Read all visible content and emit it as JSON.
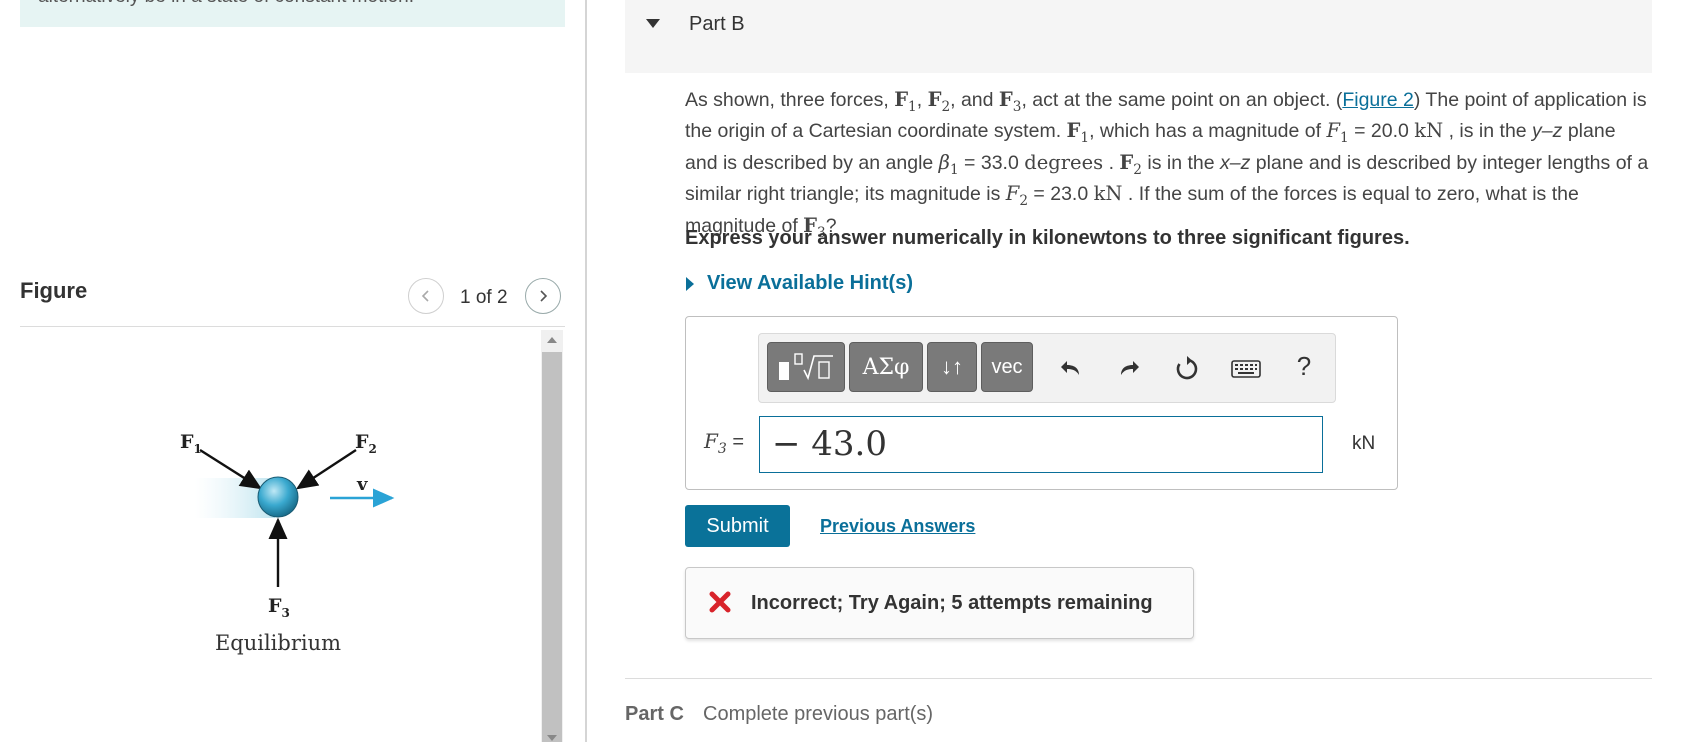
{
  "intro": {
    "text": "alternatively be in a state of constant motion."
  },
  "figure_panel": {
    "title": "Figure",
    "counter": "1 of 2",
    "labels": {
      "f1": "F",
      "f1_sub": "1",
      "f2": "F",
      "f2_sub": "2",
      "f3": "F",
      "f3_sub": "3",
      "v": "v",
      "caption": "Equilibrium"
    }
  },
  "part_b": {
    "title": "Part B",
    "question": {
      "t1": "As shown, three forces, ",
      "f1": "F",
      "s1": "1",
      "t2": ",  ",
      "f2": "F",
      "s2": "2",
      "t3": ", and ",
      "f3": "F",
      "s3": "3",
      "t4": ", act at the same point on an object. (",
      "link": "Figure 2",
      "t5": ") The point of application is the origin of a Cartesian coordinate system. ",
      "f1b": "F",
      "s1b": "1",
      "t6": ", which has a magnitude of ",
      "m1": "F",
      "m1s": "1",
      "t7": " = 20.0 ",
      "u1": "kN",
      "t8": " , is in the ",
      "yz": "y–z",
      "t9": " plane and is described by an angle ",
      "beta": "β",
      "betas": "1",
      "t10": " = 33.0 ",
      "deg": "degrees",
      "t11": " .  ",
      "f2b": "F",
      "s2b": "2",
      "t12": " is in the ",
      "xz": "x–z",
      "t13": " plane and is described by integer lengths of a similar right triangle; its magnitude is ",
      "m2": "F",
      "m2s": "2",
      "t14": " = 23.0 ",
      "u2": "kN",
      "t15": " .  If the sum of the forces is equal to zero, what is the magnitude of ",
      "f3b": "F",
      "s3b": "3",
      "t16": "?"
    },
    "instruction": "Express your answer numerically in kilonewtons to three significant figures.",
    "hint_label": "View Available Hint(s)",
    "toolbar": {
      "greek_label": "ΑΣφ",
      "arrows_label": "↓↑",
      "vec_label": "vec",
      "help_label": "?"
    },
    "answer": {
      "var_name": "F",
      "var_sub": "3",
      "equals": " =",
      "value": "− 43.0",
      "unit": "kN"
    },
    "submit_label": "Submit",
    "previous_answers_label": "Previous Answers",
    "feedback": "Incorrect; Try Again; 5 attempts remaining",
    "colors": {
      "accent": "#0a7299",
      "error": "#d8232a",
      "header_bg": "#f5f5f5",
      "intro_bg": "#e6f4f3"
    }
  },
  "part_c": {
    "title": "Part C",
    "status": "Complete previous part(s)"
  }
}
